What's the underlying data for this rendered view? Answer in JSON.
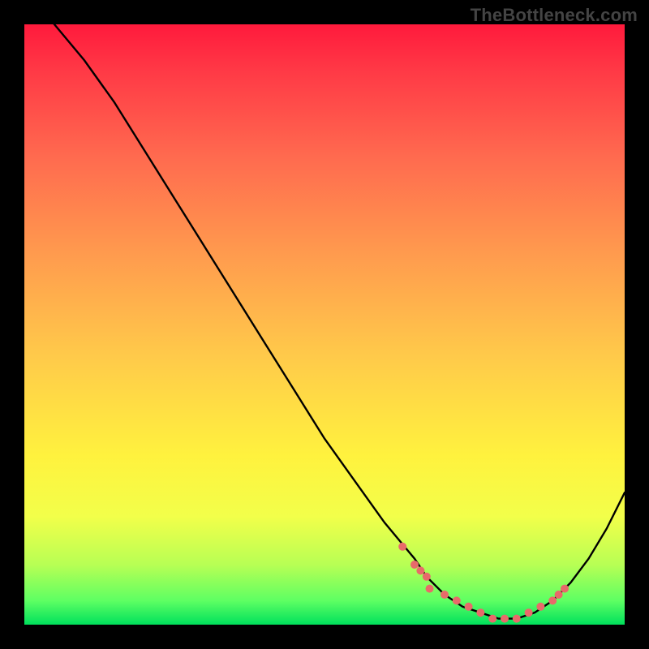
{
  "watermark": "TheBottleneck.com",
  "colors": {
    "background": "#000000",
    "curve": "#000000",
    "marker": "#e86a6a",
    "gradient_stops": [
      "#ff1a3c",
      "#ff3a46",
      "#ff6a4f",
      "#ff9a4e",
      "#ffc94a",
      "#fff23e",
      "#f2ff4a",
      "#b8ff54",
      "#5eff63",
      "#00e05c"
    ]
  },
  "chart_data": {
    "type": "line",
    "title": "",
    "xlabel": "",
    "ylabel": "",
    "xlim": [
      0,
      100
    ],
    "ylim": [
      0,
      100
    ],
    "grid": false,
    "legend": false,
    "series": [
      {
        "name": "bottleneck-curve",
        "x": [
          0,
          5,
          10,
          15,
          20,
          25,
          30,
          35,
          40,
          45,
          50,
          55,
          60,
          65,
          67,
          70,
          73,
          76,
          79,
          82,
          85,
          88,
          91,
          94,
          97,
          100
        ],
        "y": [
          106,
          100,
          94,
          87,
          79,
          71,
          63,
          55,
          47,
          39,
          31,
          24,
          17,
          11,
          8,
          5,
          3,
          2,
          1,
          1,
          2,
          4,
          7,
          11,
          16,
          22
        ]
      }
    ],
    "markers": {
      "name": "highlight-dots",
      "x": [
        63,
        65,
        66,
        67,
        67.5,
        70,
        72,
        74,
        76,
        78,
        80,
        82,
        84,
        86,
        88,
        89,
        90
      ],
      "y": [
        13,
        10,
        9,
        8,
        6,
        5,
        4,
        3,
        2,
        1,
        1,
        1,
        2,
        3,
        4,
        5,
        6
      ]
    }
  }
}
